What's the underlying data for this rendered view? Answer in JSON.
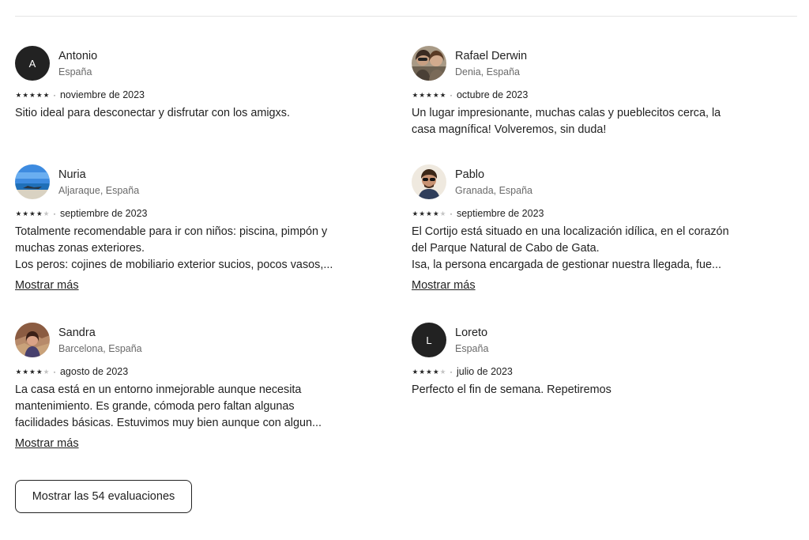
{
  "reviews": [
    {
      "name": "Antonio",
      "location": "España",
      "avatar": "initial",
      "initial": "A",
      "rating": 5,
      "date": "noviembre de 2023",
      "lines": [
        "Sitio ideal para desconectar y disfrutar con los amigxs."
      ],
      "more_label": ""
    },
    {
      "name": "Rafael Derwin",
      "location": "Denia, España",
      "avatar": "photo-two-people",
      "initial": "",
      "rating": 5,
      "date": "octubre de 2023",
      "lines": [
        "Un lugar impresionante, muchas calas y pueblecitos cerca, la",
        "casa magnífica! Volveremos, sin duda!"
      ],
      "more_label": ""
    },
    {
      "name": "Nuria",
      "location": "Aljaraque, España",
      "avatar": "photo-beach",
      "initial": "",
      "rating": 4,
      "date": "septiembre de 2023",
      "lines": [
        "Totalmente recomendable para ir con niños: piscina, pimpón y",
        "muchas zonas exteriores.",
        "Los peros: cojines de mobiliario exterior sucios, pocos vasos,..."
      ],
      "more_label": "Mostrar más"
    },
    {
      "name": "Pablo",
      "location": "Granada, España",
      "avatar": "photo-man-sunglasses",
      "initial": "",
      "rating": 4,
      "date": "septiembre de 2023",
      "lines": [
        "El Cortijo está situado en una localización idílica, en el corazón",
        "del Parque Natural de Cabo de Gata.",
        "Isa, la persona encargada de gestionar nuestra llegada, fue..."
      ],
      "more_label": "Mostrar más"
    },
    {
      "name": "Sandra",
      "location": "Barcelona, España",
      "avatar": "photo-woman",
      "initial": "",
      "rating": 4,
      "date": "agosto de 2023",
      "lines": [
        "La casa está en un entorno inmejorable aunque necesita",
        "mantenimiento. Es grande, cómoda pero faltan algunas",
        "facilidades básicas. Estuvimos muy bien aunque con algun..."
      ],
      "more_label": "Mostrar más"
    },
    {
      "name": "Loreto",
      "location": "España",
      "avatar": "initial",
      "initial": "L",
      "rating": 4,
      "date": "julio de 2023",
      "lines": [
        "Perfecto el fin de semana. Repetiremos"
      ],
      "more_label": ""
    }
  ],
  "separator": "·",
  "star_glyph": "★",
  "show_all_label": "Mostrar las 54 evaluaciones"
}
